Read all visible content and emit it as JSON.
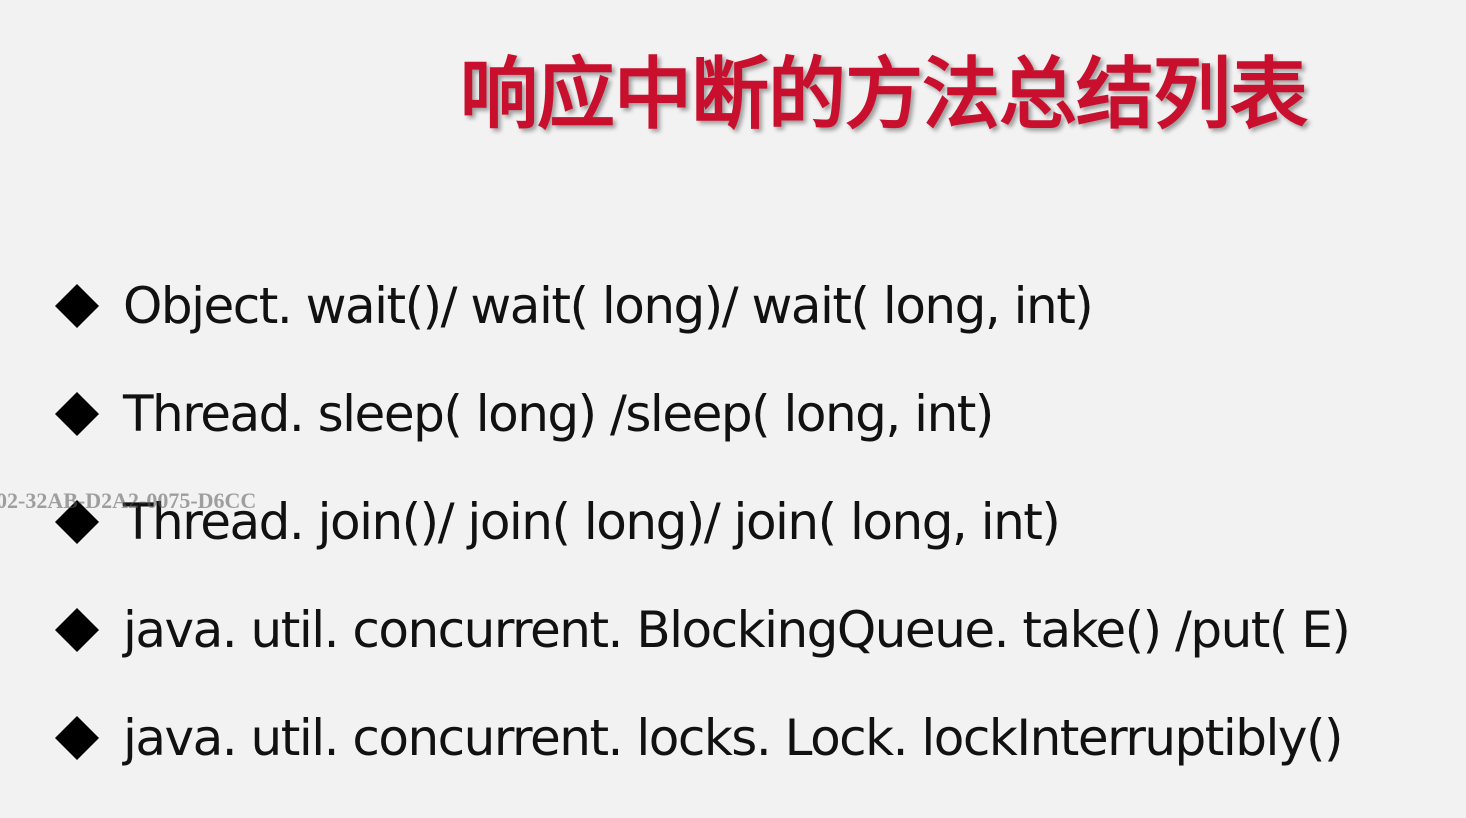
{
  "slide": {
    "title": "响应中断的方法总结列表",
    "items": [
      {
        "text": "Object. wait()/ wait( long)/ wait( long, int)"
      },
      {
        "text": "Thread. sleep( long) /sleep( long, int)"
      },
      {
        "text": "Thread. join()/ join( long)/ join( long, int)"
      },
      {
        "text": "java. util. concurrent. BlockingQueue. take() /put( E)"
      },
      {
        "text": "java. util. concurrent. locks. Lock. lockInterruptibly()"
      }
    ],
    "bullet_icon": "diamond-bullet-icon",
    "watermark": "02-32AB-D2A2-0075-D6CC"
  },
  "colors": {
    "background": "#f2f2f2",
    "title": "#c8102e",
    "text": "#111111"
  }
}
